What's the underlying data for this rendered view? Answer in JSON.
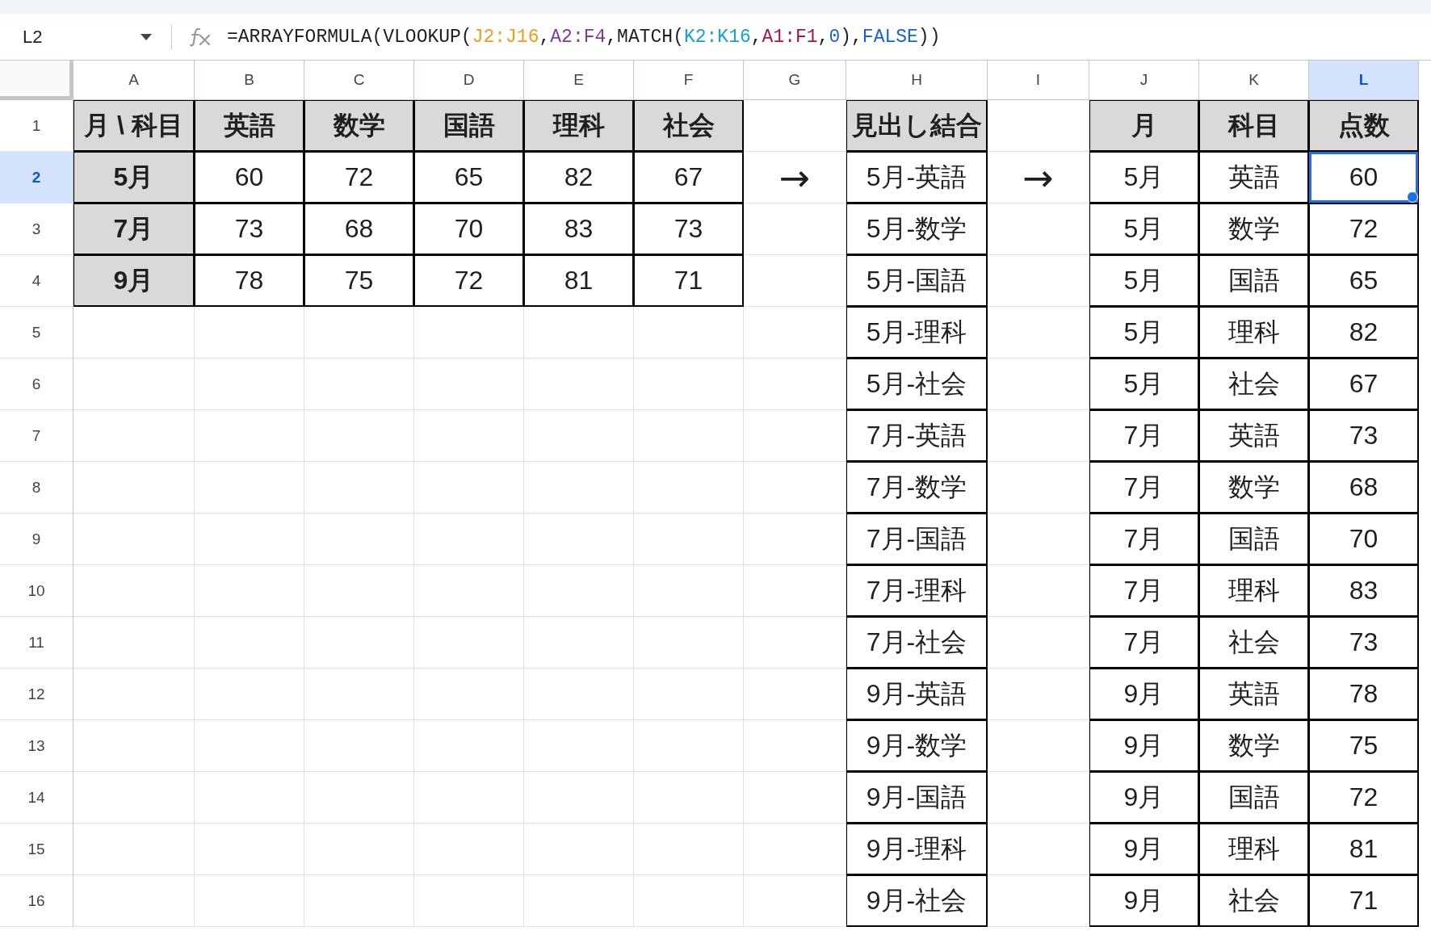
{
  "formula_bar": {
    "name_box": "L2",
    "formula": [
      {
        "text": "=ARRAYFORMULA(VLOOKUP(",
        "color": "#1f1f1f"
      },
      {
        "text": "J2:J16",
        "color": "#f29b1d"
      },
      {
        "text": ",",
        "color": "#1f1f1f"
      },
      {
        "text": "A2:F4",
        "color": "#7c3d96"
      },
      {
        "text": ",MATCH(",
        "color": "#1f1f1f"
      },
      {
        "text": "K2:K16",
        "color": "#12a4cf"
      },
      {
        "text": ",",
        "color": "#1f1f1f"
      },
      {
        "text": "A1:F1",
        "color": "#a3164f"
      },
      {
        "text": ",",
        "color": "#1f1f1f"
      },
      {
        "text": "0",
        "color": "#1a5fd6"
      },
      {
        "text": "),",
        "color": "#1f1f1f"
      },
      {
        "text": "FALSE",
        "color": "#1a5fd6"
      },
      {
        "text": "))",
        "color": "#1f1f1f"
      }
    ]
  },
  "columns": [
    {
      "label": "A",
      "selected": false
    },
    {
      "label": "B",
      "selected": false
    },
    {
      "label": "C",
      "selected": false
    },
    {
      "label": "D",
      "selected": false
    },
    {
      "label": "E",
      "selected": false
    },
    {
      "label": "F",
      "selected": false
    },
    {
      "label": "G",
      "selected": false
    },
    {
      "label": "H",
      "selected": false
    },
    {
      "label": "I",
      "selected": false
    },
    {
      "label": "J",
      "selected": false
    },
    {
      "label": "K",
      "selected": false
    },
    {
      "label": "L",
      "selected": true
    }
  ],
  "rows": [
    {
      "number": "1",
      "selected": false,
      "cells": [
        {
          "kind": "header",
          "text": "月 \\ 科目",
          "selected": false
        },
        {
          "kind": "header",
          "text": "英語",
          "selected": false
        },
        {
          "kind": "header",
          "text": "数学",
          "selected": false
        },
        {
          "kind": "header",
          "text": "国語",
          "selected": false
        },
        {
          "kind": "header",
          "text": "理科",
          "selected": false
        },
        {
          "kind": "header",
          "text": "社会",
          "selected": false
        },
        {
          "kind": "empty",
          "selected": false
        },
        {
          "kind": "header",
          "text": "見出し結合",
          "selected": false
        },
        {
          "kind": "empty",
          "selected": false
        },
        {
          "kind": "header",
          "text": "月",
          "selected": false
        },
        {
          "kind": "header",
          "text": "科目",
          "selected": false
        },
        {
          "kind": "header",
          "text": "点数",
          "selected": false
        }
      ]
    },
    {
      "number": "2",
      "selected": true,
      "cells": [
        {
          "kind": "header",
          "text": "5月",
          "selected": false
        },
        {
          "kind": "data",
          "text": "60",
          "selected": false
        },
        {
          "kind": "data",
          "text": "72",
          "selected": false
        },
        {
          "kind": "data",
          "text": "65",
          "selected": false
        },
        {
          "kind": "data",
          "text": "82",
          "selected": false
        },
        {
          "kind": "data",
          "text": "67",
          "selected": false
        },
        {
          "kind": "plain",
          "text": "→",
          "selected": false
        },
        {
          "kind": "data",
          "text": "5月-英語",
          "selected": false
        },
        {
          "kind": "plain",
          "text": "→",
          "selected": false
        },
        {
          "kind": "data",
          "text": "5月",
          "selected": false
        },
        {
          "kind": "data",
          "text": "英語",
          "selected": false
        },
        {
          "kind": "data",
          "text": "60",
          "selected": true
        }
      ]
    },
    {
      "number": "3",
      "selected": false,
      "cells": [
        {
          "kind": "header",
          "text": "7月",
          "selected": false
        },
        {
          "kind": "data",
          "text": "73",
          "selected": false
        },
        {
          "kind": "data",
          "text": "68",
          "selected": false
        },
        {
          "kind": "data",
          "text": "70",
          "selected": false
        },
        {
          "kind": "data",
          "text": "83",
          "selected": false
        },
        {
          "kind": "data",
          "text": "73",
          "selected": false
        },
        {
          "kind": "empty",
          "selected": false
        },
        {
          "kind": "data",
          "text": "5月-数学",
          "selected": false
        },
        {
          "kind": "empty",
          "selected": false
        },
        {
          "kind": "data",
          "text": "5月",
          "selected": false
        },
        {
          "kind": "data",
          "text": "数学",
          "selected": false
        },
        {
          "kind": "data",
          "text": "72",
          "selected": false
        }
      ]
    },
    {
      "number": "4",
      "selected": false,
      "cells": [
        {
          "kind": "header",
          "text": "9月",
          "selected": false
        },
        {
          "kind": "data",
          "text": "78",
          "selected": false
        },
        {
          "kind": "data",
          "text": "75",
          "selected": false
        },
        {
          "kind": "data",
          "text": "72",
          "selected": false
        },
        {
          "kind": "data",
          "text": "81",
          "selected": false
        },
        {
          "kind": "data",
          "text": "71",
          "selected": false
        },
        {
          "kind": "empty",
          "selected": false
        },
        {
          "kind": "data",
          "text": "5月-国語",
          "selected": false
        },
        {
          "kind": "empty",
          "selected": false
        },
        {
          "kind": "data",
          "text": "5月",
          "selected": false
        },
        {
          "kind": "data",
          "text": "国語",
          "selected": false
        },
        {
          "kind": "data",
          "text": "65",
          "selected": false
        }
      ]
    },
    {
      "number": "5",
      "selected": false,
      "cells": [
        {
          "kind": "empty",
          "selected": false
        },
        {
          "kind": "empty",
          "selected": false
        },
        {
          "kind": "empty",
          "selected": false
        },
        {
          "kind": "empty",
          "selected": false
        },
        {
          "kind": "empty",
          "selected": false
        },
        {
          "kind": "empty",
          "selected": false
        },
        {
          "kind": "empty",
          "selected": false
        },
        {
          "kind": "data",
          "text": "5月-理科",
          "selected": false
        },
        {
          "kind": "empty",
          "selected": false
        },
        {
          "kind": "data",
          "text": "5月",
          "selected": false
        },
        {
          "kind": "data",
          "text": "理科",
          "selected": false
        },
        {
          "kind": "data",
          "text": "82",
          "selected": false
        }
      ]
    },
    {
      "number": "6",
      "selected": false,
      "cells": [
        {
          "kind": "empty",
          "selected": false
        },
        {
          "kind": "empty",
          "selected": false
        },
        {
          "kind": "empty",
          "selected": false
        },
        {
          "kind": "empty",
          "selected": false
        },
        {
          "kind": "empty",
          "selected": false
        },
        {
          "kind": "empty",
          "selected": false
        },
        {
          "kind": "empty",
          "selected": false
        },
        {
          "kind": "data",
          "text": "5月-社会",
          "selected": false
        },
        {
          "kind": "empty",
          "selected": false
        },
        {
          "kind": "data",
          "text": "5月",
          "selected": false
        },
        {
          "kind": "data",
          "text": "社会",
          "selected": false
        },
        {
          "kind": "data",
          "text": "67",
          "selected": false
        }
      ]
    },
    {
      "number": "7",
      "selected": false,
      "cells": [
        {
          "kind": "empty",
          "selected": false
        },
        {
          "kind": "empty",
          "selected": false
        },
        {
          "kind": "empty",
          "selected": false
        },
        {
          "kind": "empty",
          "selected": false
        },
        {
          "kind": "empty",
          "selected": false
        },
        {
          "kind": "empty",
          "selected": false
        },
        {
          "kind": "empty",
          "selected": false
        },
        {
          "kind": "data",
          "text": "7月-英語",
          "selected": false
        },
        {
          "kind": "empty",
          "selected": false
        },
        {
          "kind": "data",
          "text": "7月",
          "selected": false
        },
        {
          "kind": "data",
          "text": "英語",
          "selected": false
        },
        {
          "kind": "data",
          "text": "73",
          "selected": false
        }
      ]
    },
    {
      "number": "8",
      "selected": false,
      "cells": [
        {
          "kind": "empty",
          "selected": false
        },
        {
          "kind": "empty",
          "selected": false
        },
        {
          "kind": "empty",
          "selected": false
        },
        {
          "kind": "empty",
          "selected": false
        },
        {
          "kind": "empty",
          "selected": false
        },
        {
          "kind": "empty",
          "selected": false
        },
        {
          "kind": "empty",
          "selected": false
        },
        {
          "kind": "data",
          "text": "7月-数学",
          "selected": false
        },
        {
          "kind": "empty",
          "selected": false
        },
        {
          "kind": "data",
          "text": "7月",
          "selected": false
        },
        {
          "kind": "data",
          "text": "数学",
          "selected": false
        },
        {
          "kind": "data",
          "text": "68",
          "selected": false
        }
      ]
    },
    {
      "number": "9",
      "selected": false,
      "cells": [
        {
          "kind": "empty",
          "selected": false
        },
        {
          "kind": "empty",
          "selected": false
        },
        {
          "kind": "empty",
          "selected": false
        },
        {
          "kind": "empty",
          "selected": false
        },
        {
          "kind": "empty",
          "selected": false
        },
        {
          "kind": "empty",
          "selected": false
        },
        {
          "kind": "empty",
          "selected": false
        },
        {
          "kind": "data",
          "text": "7月-国語",
          "selected": false
        },
        {
          "kind": "empty",
          "selected": false
        },
        {
          "kind": "data",
          "text": "7月",
          "selected": false
        },
        {
          "kind": "data",
          "text": "国語",
          "selected": false
        },
        {
          "kind": "data",
          "text": "70",
          "selected": false
        }
      ]
    },
    {
      "number": "10",
      "selected": false,
      "cells": [
        {
          "kind": "empty",
          "selected": false
        },
        {
          "kind": "empty",
          "selected": false
        },
        {
          "kind": "empty",
          "selected": false
        },
        {
          "kind": "empty",
          "selected": false
        },
        {
          "kind": "empty",
          "selected": false
        },
        {
          "kind": "empty",
          "selected": false
        },
        {
          "kind": "empty",
          "selected": false
        },
        {
          "kind": "data",
          "text": "7月-理科",
          "selected": false
        },
        {
          "kind": "empty",
          "selected": false
        },
        {
          "kind": "data",
          "text": "7月",
          "selected": false
        },
        {
          "kind": "data",
          "text": "理科",
          "selected": false
        },
        {
          "kind": "data",
          "text": "83",
          "selected": false
        }
      ]
    },
    {
      "number": "11",
      "selected": false,
      "cells": [
        {
          "kind": "empty",
          "selected": false
        },
        {
          "kind": "empty",
          "selected": false
        },
        {
          "kind": "empty",
          "selected": false
        },
        {
          "kind": "empty",
          "selected": false
        },
        {
          "kind": "empty",
          "selected": false
        },
        {
          "kind": "empty",
          "selected": false
        },
        {
          "kind": "empty",
          "selected": false
        },
        {
          "kind": "data",
          "text": "7月-社会",
          "selected": false
        },
        {
          "kind": "empty",
          "selected": false
        },
        {
          "kind": "data",
          "text": "7月",
          "selected": false
        },
        {
          "kind": "data",
          "text": "社会",
          "selected": false
        },
        {
          "kind": "data",
          "text": "73",
          "selected": false
        }
      ]
    },
    {
      "number": "12",
      "selected": false,
      "cells": [
        {
          "kind": "empty",
          "selected": false
        },
        {
          "kind": "empty",
          "selected": false
        },
        {
          "kind": "empty",
          "selected": false
        },
        {
          "kind": "empty",
          "selected": false
        },
        {
          "kind": "empty",
          "selected": false
        },
        {
          "kind": "empty",
          "selected": false
        },
        {
          "kind": "empty",
          "selected": false
        },
        {
          "kind": "data",
          "text": "9月-英語",
          "selected": false
        },
        {
          "kind": "empty",
          "selected": false
        },
        {
          "kind": "data",
          "text": "9月",
          "selected": false
        },
        {
          "kind": "data",
          "text": "英語",
          "selected": false
        },
        {
          "kind": "data",
          "text": "78",
          "selected": false
        }
      ]
    },
    {
      "number": "13",
      "selected": false,
      "cells": [
        {
          "kind": "empty",
          "selected": false
        },
        {
          "kind": "empty",
          "selected": false
        },
        {
          "kind": "empty",
          "selected": false
        },
        {
          "kind": "empty",
          "selected": false
        },
        {
          "kind": "empty",
          "selected": false
        },
        {
          "kind": "empty",
          "selected": false
        },
        {
          "kind": "empty",
          "selected": false
        },
        {
          "kind": "data",
          "text": "9月-数学",
          "selected": false
        },
        {
          "kind": "empty",
          "selected": false
        },
        {
          "kind": "data",
          "text": "9月",
          "selected": false
        },
        {
          "kind": "data",
          "text": "数学",
          "selected": false
        },
        {
          "kind": "data",
          "text": "75",
          "selected": false
        }
      ]
    },
    {
      "number": "14",
      "selected": false,
      "cells": [
        {
          "kind": "empty",
          "selected": false
        },
        {
          "kind": "empty",
          "selected": false
        },
        {
          "kind": "empty",
          "selected": false
        },
        {
          "kind": "empty",
          "selected": false
        },
        {
          "kind": "empty",
          "selected": false
        },
        {
          "kind": "empty",
          "selected": false
        },
        {
          "kind": "empty",
          "selected": false
        },
        {
          "kind": "data",
          "text": "9月-国語",
          "selected": false
        },
        {
          "kind": "empty",
          "selected": false
        },
        {
          "kind": "data",
          "text": "9月",
          "selected": false
        },
        {
          "kind": "data",
          "text": "国語",
          "selected": false
        },
        {
          "kind": "data",
          "text": "72",
          "selected": false
        }
      ]
    },
    {
      "number": "15",
      "selected": false,
      "cells": [
        {
          "kind": "empty",
          "selected": false
        },
        {
          "kind": "empty",
          "selected": false
        },
        {
          "kind": "empty",
          "selected": false
        },
        {
          "kind": "empty",
          "selected": false
        },
        {
          "kind": "empty",
          "selected": false
        },
        {
          "kind": "empty",
          "selected": false
        },
        {
          "kind": "empty",
          "selected": false
        },
        {
          "kind": "data",
          "text": "9月-理科",
          "selected": false
        },
        {
          "kind": "empty",
          "selected": false
        },
        {
          "kind": "data",
          "text": "9月",
          "selected": false
        },
        {
          "kind": "data",
          "text": "理科",
          "selected": false
        },
        {
          "kind": "data",
          "text": "81",
          "selected": false
        }
      ]
    },
    {
      "number": "16",
      "selected": false,
      "cells": [
        {
          "kind": "empty",
          "selected": false
        },
        {
          "kind": "empty",
          "selected": false
        },
        {
          "kind": "empty",
          "selected": false
        },
        {
          "kind": "empty",
          "selected": false
        },
        {
          "kind": "empty",
          "selected": false
        },
        {
          "kind": "empty",
          "selected": false
        },
        {
          "kind": "empty",
          "selected": false
        },
        {
          "kind": "data",
          "text": "9月-社会",
          "selected": false
        },
        {
          "kind": "empty",
          "selected": false
        },
        {
          "kind": "data",
          "text": "9月",
          "selected": false
        },
        {
          "kind": "data",
          "text": "社会",
          "selected": false
        },
        {
          "kind": "data",
          "text": "71",
          "selected": false
        }
      ]
    }
  ]
}
